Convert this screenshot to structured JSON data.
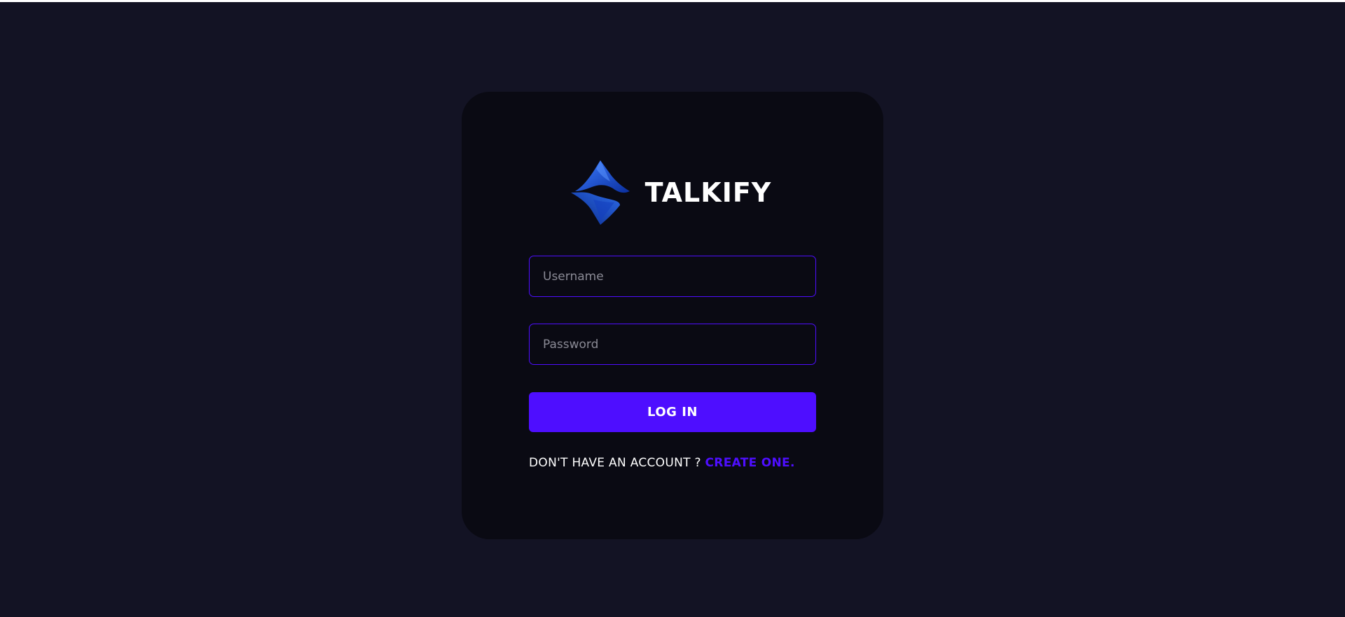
{
  "brand": {
    "name": "TALKIFY",
    "logo_icon": "s-diamond-logo-icon",
    "logo_color_light": "#2d6be8",
    "logo_color_dark": "#0b2f9e"
  },
  "form": {
    "username": {
      "placeholder": "Username",
      "value": ""
    },
    "password": {
      "placeholder": "Password",
      "value": ""
    },
    "submit_label": "LOG IN"
  },
  "signup": {
    "prompt": "DON'T HAVE AN ACCOUNT ?",
    "link_label": "CREATE ONE."
  },
  "colors": {
    "page_background": "#131324",
    "card_background": "#0a0a13",
    "accent": "#4e0eff",
    "text": "#ffffff",
    "placeholder": "#8a8a95"
  }
}
